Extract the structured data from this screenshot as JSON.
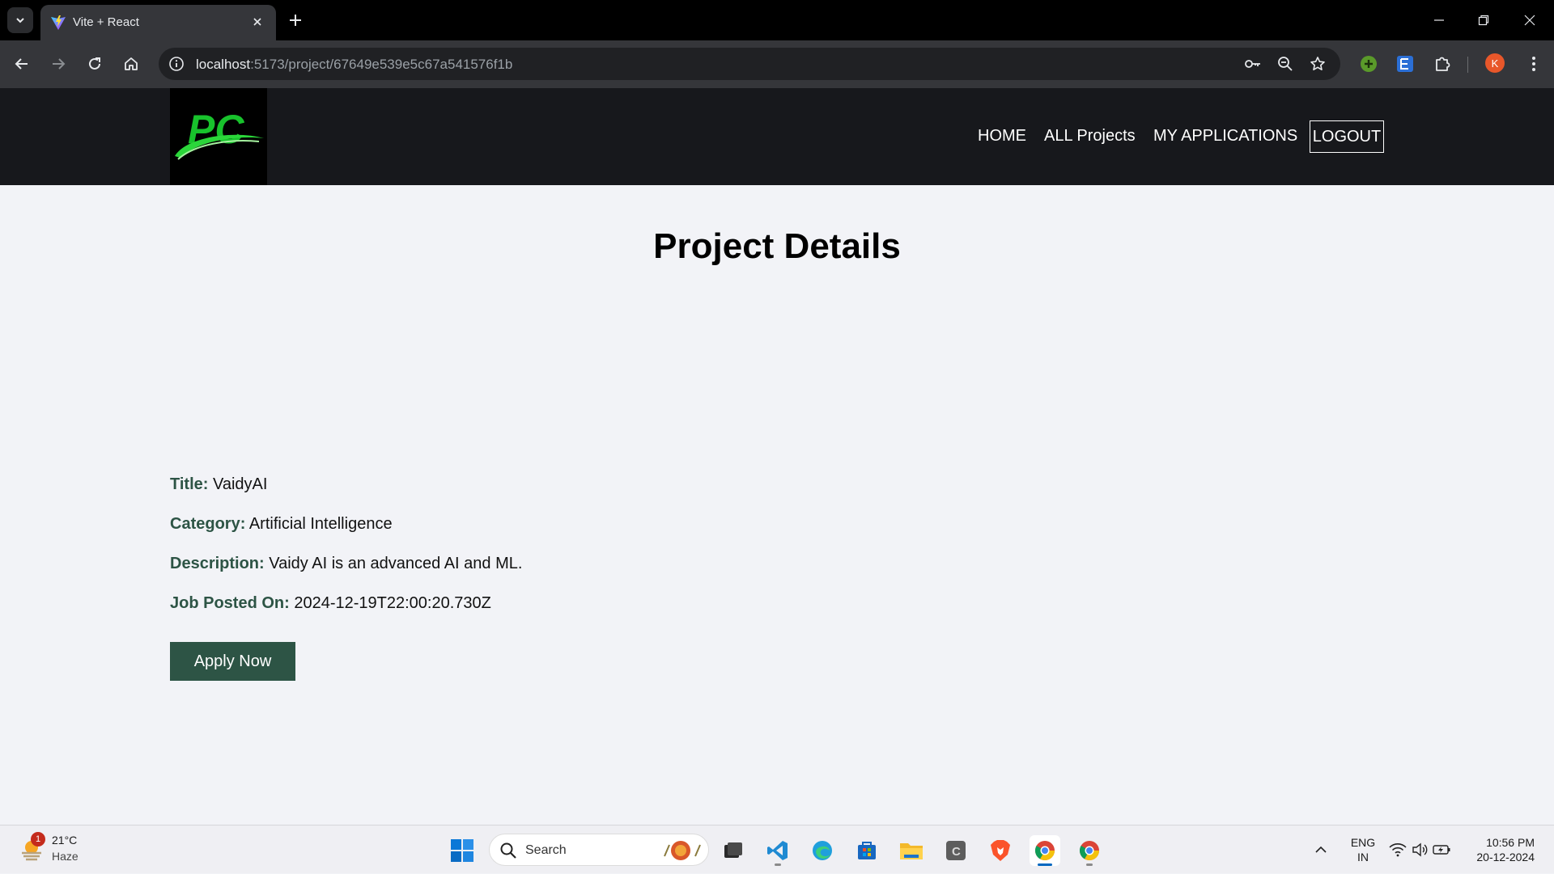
{
  "browser": {
    "tab_title": "Vite + React",
    "url_host": "localhost",
    "url_path": ":5173/project/67649e539e5c67a541576f1b",
    "profile_initial": "K"
  },
  "navbar": {
    "logo_text": "PC",
    "links": [
      "HOME",
      "ALL Projects",
      "MY APPLICATIONS"
    ],
    "logout_label": "LOGOUT"
  },
  "page": {
    "title": "Project Details",
    "details": [
      {
        "label": "Title:",
        "value": "VaidyAI"
      },
      {
        "label": "Category:",
        "value": "Artificial Intelligence"
      },
      {
        "label": "Description:",
        "value": "Vaidy AI is an advanced AI and ML."
      },
      {
        "label": "Job Posted On:",
        "value": "2024-12-19T22:00:20.730Z"
      }
    ],
    "apply_label": "Apply Now"
  },
  "taskbar": {
    "weather_temp": "21°C",
    "weather_cond": "Haze",
    "weather_badge": "1",
    "search_placeholder": "Search",
    "lang_line1": "ENG",
    "lang_line2": "IN",
    "time": "10:56 PM",
    "date": "20-12-2024"
  },
  "colors": {
    "accent_green": "#2d5445",
    "navbar_bg": "#17181c",
    "page_bg": "#f2f3f7"
  }
}
